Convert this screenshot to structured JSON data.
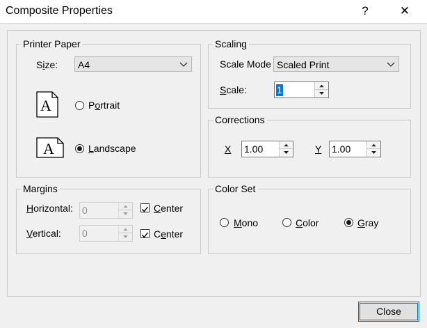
{
  "window": {
    "title": "Composite Properties",
    "help_button": "?",
    "close_button": "✕"
  },
  "printer_paper": {
    "legend": "Printer Paper",
    "size_label_prefix": "S",
    "size_label_underlined": "i",
    "size_label_suffix": "ze:",
    "size_value": "A4",
    "orientation_glyph": "A",
    "portrait_label_prefix": "P",
    "portrait_label_underlined": "o",
    "portrait_label_suffix": "rtrait",
    "landscape_label_prefix": "",
    "landscape_label_underlined": "L",
    "landscape_label_suffix": "andscape",
    "orientation_selected": "Landscape"
  },
  "scaling": {
    "legend": "Scaling",
    "scale_mode_label": "Scale Mode",
    "scale_mode_value": "Scaled Print",
    "scale_label_underlined": "S",
    "scale_label_suffix": "cale:",
    "scale_value": "1"
  },
  "corrections": {
    "legend": "Corrections",
    "x_label": "X",
    "x_value": "1.00",
    "y_label": "Y",
    "y_value": "1.00"
  },
  "margins": {
    "legend": "Margins",
    "horizontal_label_underlined": "H",
    "horizontal_label_suffix": "orizontal:",
    "horizontal_value": "0",
    "vertical_label_underlined": "V",
    "vertical_label_suffix": "ertical:",
    "vertical_value": "0",
    "center_label_underlined": "C",
    "center_label_suffix": "enter",
    "center2_label_prefix": "C",
    "center2_label_underlined": "e",
    "center2_label_suffix": "nter"
  },
  "color_set": {
    "legend": "Color Set",
    "mono_label_underlined": "M",
    "mono_label_suffix": "ono",
    "color_label_underlined": "C",
    "color_label_suffix": "olor",
    "gray_label_underlined": "G",
    "gray_label_suffix": "ray",
    "selected": "Gray"
  },
  "footer": {
    "close_label": "Close"
  }
}
